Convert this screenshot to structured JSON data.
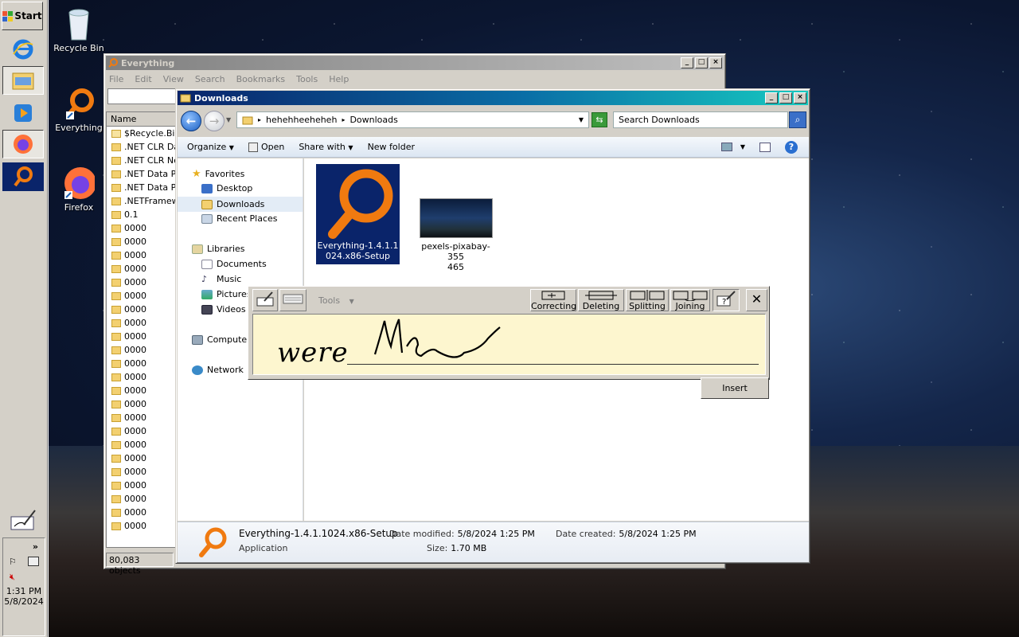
{
  "taskbar": {
    "start_label": "Start",
    "tray": {
      "chevron": "»",
      "time": "1:31 PM",
      "date": "5/8/2024"
    }
  },
  "desktop": {
    "icons": [
      {
        "label": "Recycle Bin",
        "icon": "recycle-bin-icon"
      },
      {
        "label": "Everything",
        "icon": "everything-icon"
      },
      {
        "label": "Firefox",
        "icon": "firefox-icon"
      }
    ]
  },
  "everything_window": {
    "title": "Everything",
    "menu": [
      "File",
      "Edit",
      "View",
      "Search",
      "Bookmarks",
      "Tools",
      "Help"
    ],
    "search_value": "",
    "column_name": "Name",
    "rows": [
      "$Recycle.Bin",
      ".NET CLR Dat",
      ".NET CLR Net",
      ".NET Data Pr",
      ".NET Data Pr",
      ".NETFramewo",
      "0.1",
      "0000",
      "0000",
      "0000",
      "0000",
      "0000",
      "0000",
      "0000",
      "0000",
      "0000",
      "0000",
      "0000",
      "0000",
      "0000",
      "0000",
      "0000",
      "0000",
      "0000",
      "0000",
      "0000",
      "0000",
      "0000",
      "0000",
      "0000"
    ],
    "status": "80,083 objects"
  },
  "explorer": {
    "title": "Downloads",
    "breadcrumb": [
      "hehehheeheheh",
      "Downloads"
    ],
    "search_placeholder": "Search Downloads",
    "toolbar": {
      "organize": "Organize",
      "open": "Open",
      "share": "Share with",
      "new_folder": "New folder"
    },
    "nav": {
      "favorites": "Favorites",
      "desktop": "Desktop",
      "downloads": "Downloads",
      "recent": "Recent Places",
      "libraries": "Libraries",
      "documents": "Documents",
      "music": "Music",
      "pictures": "Pictures",
      "videos": "Videos",
      "computer": "Computer",
      "network": "Network"
    },
    "files": [
      {
        "name_line1": "Everything-1.4.1.1",
        "name_line2": "024.x86-Setup",
        "selected": true
      },
      {
        "name_line1": "pexels-pixabay-355",
        "name_line2": "465",
        "selected": false
      }
    ],
    "details": {
      "filename": "Everything-1.4.1.1024.x86-Setup",
      "type": "Application",
      "date_modified_label": "Date modified:",
      "date_modified": "5/8/2024 1:25 PM",
      "size_label": "Size:",
      "size": "1.70 MB",
      "date_created_label": "Date created:",
      "date_created": "5/8/2024 1:25 PM"
    }
  },
  "input_panel": {
    "tools_label": "Tools",
    "correcting": "Correcting",
    "deleting": "Deleting",
    "splitting": "Splitting",
    "joining": "Joining",
    "recognized_text": "were",
    "insert_label": "Insert"
  }
}
